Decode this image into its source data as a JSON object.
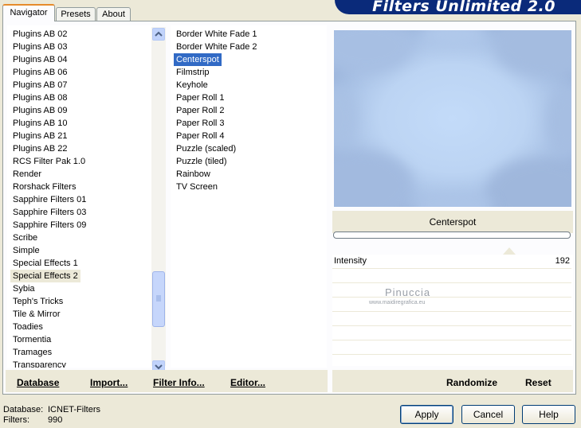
{
  "tabs": [
    {
      "label": "Navigator",
      "active": true
    },
    {
      "label": "Presets",
      "active": false
    },
    {
      "label": "About",
      "active": false
    }
  ],
  "banner_title": "Filters Unlimited 2.0",
  "categories": [
    "Plugins AB 02",
    "Plugins AB 03",
    "Plugins AB 04",
    "Plugins AB 06",
    "Plugins AB 07",
    "Plugins AB 08",
    "Plugins AB 09",
    "Plugins AB 10",
    "Plugins AB 21",
    "Plugins AB 22",
    "RCS Filter Pak 1.0",
    "Render",
    "Rorshack Filters",
    "Sapphire Filters 01",
    "Sapphire Filters 03",
    "Sapphire Filters 09",
    "Scribe",
    "Simple",
    "Special Effects 1",
    "Special Effects 2",
    "Sybia",
    "Teph's Tricks",
    "Tile & Mirror",
    "Toadies",
    "Tormentia",
    "Tramages",
    "Transparency"
  ],
  "selected_category": "Special Effects 2",
  "filters": [
    "Border White Fade 1",
    "Border White Fade 2",
    "Centerspot",
    "Filmstrip",
    "Keyhole",
    "Paper Roll 1",
    "Paper Roll 2",
    "Paper Roll 3",
    "Paper Roll 4",
    "Puzzle (scaled)",
    "Puzzle (tiled)",
    "Rainbow",
    "TV Screen"
  ],
  "selected_filter": "Centerspot",
  "links": {
    "database": "Database",
    "import": "Import...",
    "filter_info": "Filter Info...",
    "editor": "Editor...",
    "randomize": "Randomize",
    "reset": "Reset"
  },
  "preview_caption": "Centerspot",
  "parameters": [
    {
      "label": "Intensity",
      "value": "192"
    }
  ],
  "watermark": {
    "name": "Pinuccia",
    "site": "www.maidiregrafica.eu"
  },
  "status": {
    "database_label": "Database:",
    "database_value": "ICNET-Filters",
    "filters_label": "Filters:",
    "filters_value": "990"
  },
  "buttons": {
    "apply": "Apply",
    "cancel": "Cancel",
    "help": "Help"
  },
  "colors": {
    "selection_blue": "#316ac5",
    "banner_navy": "#0a2a7a"
  }
}
